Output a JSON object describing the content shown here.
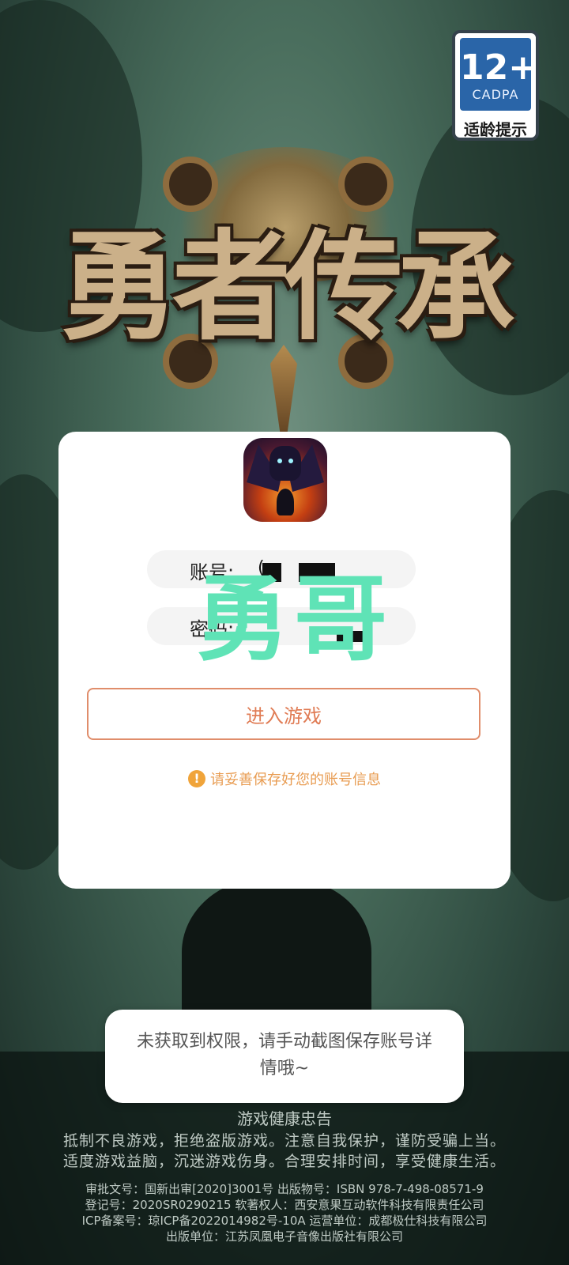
{
  "age_badge": {
    "age": "12+",
    "org": "CADPA",
    "hint": "适龄提示"
  },
  "game_logo": {
    "title": "勇者传承"
  },
  "login": {
    "account_label": "账号:",
    "account_value": "(",
    "password_label": "密码:",
    "watermark": "勇哥",
    "enter_button": "进入游戏",
    "notice": "请妥善保存好您的账号信息",
    "notice_icon": "exclamation-icon"
  },
  "toast": {
    "text": "未获取到权限，请手动截图保存账号详情哦~"
  },
  "health_notice": {
    "title": "游戏健康忠告",
    "line1": "抵制不良游戏，拒绝盗版游戏。注意自我保护，谨防受骗上当。",
    "line2": "适度游戏益脑，沉迷游戏伤身。合理安排时间，享受健康生活。"
  },
  "publication": {
    "line1": "审批文号：国新出审[2020]3001号 出版物号：ISBN 978-7-498-08571-9",
    "line2": "登记号：2020SR0290215 软著权人：西安意果互动软件科技有限责任公司",
    "line3": "ICP备案号：琼ICP备2022014982号-10A 运营单位：成都极仕科技有限公司",
    "line4": "出版单位：江苏凤凰电子音像出版社有限公司"
  },
  "colors": {
    "accent": "#e07c55",
    "notice": "#e89c52",
    "watermark": "#5fe3b6",
    "badge_blue": "#2a65a8"
  }
}
